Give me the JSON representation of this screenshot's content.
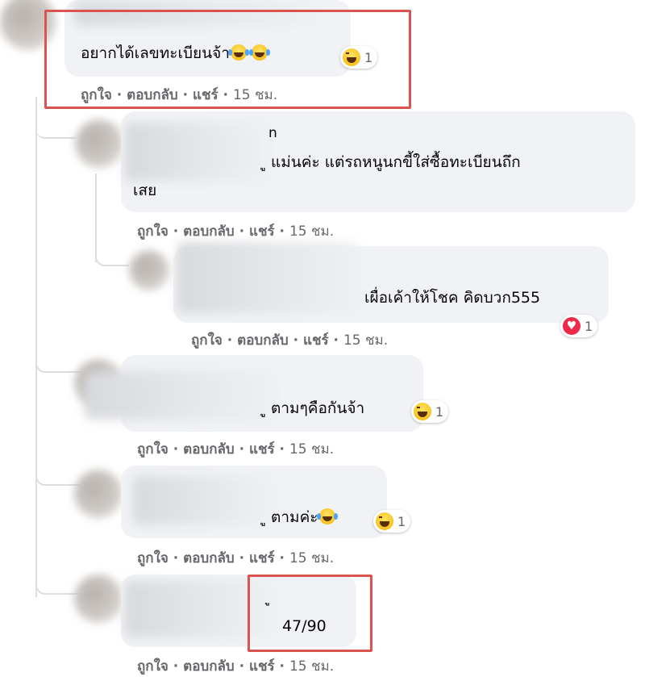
{
  "comments": [
    {
      "text": "อยากได้เลขทะเบียนจ้า",
      "reaction_count": "1",
      "actions": {
        "like": "ถูกใจ",
        "reply": "ตอบกลับ",
        "share": "แชร์",
        "time": "15 ชม."
      }
    },
    {
      "name_visible": "n",
      "line1": "ู แม่นค่ะ แต่รถหนูนกขี้ใส่ซื้อทะเบียนถึก",
      "line2": "เสย",
      "actions": {
        "like": "ถูกใจ",
        "reply": "ตอบกลับ",
        "share": "แชร์",
        "time": "15 ชม."
      }
    },
    {
      "text": "เผื่อเค้าให้โชค คิดบวก555",
      "reaction_count": "1",
      "actions": {
        "like": "ถูกใจ",
        "reply": "ตอบกลับ",
        "share": "แชร์",
        "time": "15 ชม."
      }
    },
    {
      "text": "ู ตามๆคือกันจ้า",
      "reaction_count": "1",
      "actions": {
        "like": "ถูกใจ",
        "reply": "ตอบกลับ",
        "share": "แชร์",
        "time": "15 ชม."
      }
    },
    {
      "text": "ู ตามค่ะ",
      "reaction_count": "1",
      "actions": {
        "like": "ถูกใจ",
        "reply": "ตอบกลับ",
        "share": "แชร์",
        "time": "15 ชม."
      }
    },
    {
      "name_visible": "ู",
      "text": "47/90",
      "actions": {
        "like": "ถูกใจ",
        "reply": "ตอบกลับ",
        "share": "แชร์",
        "time": "15 ชม."
      }
    }
  ],
  "colors": {
    "bubble": "#f0f2f5",
    "highlight": "#d9534f",
    "action_text": "#65676b",
    "heart": "#f02849"
  },
  "icons": [
    "haha-reaction-icon",
    "heart-reaction-icon",
    "laughing-emoji-icon"
  ]
}
